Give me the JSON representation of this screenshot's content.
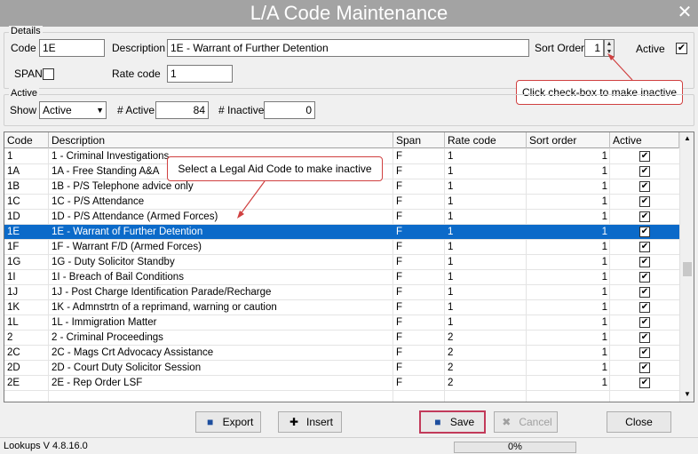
{
  "window": {
    "title": "L/A Code Maintenance",
    "close_glyph": "✕"
  },
  "details": {
    "legend": "Details",
    "code_label": "Code",
    "code_value": "1E",
    "description_label": "Description",
    "description_value": "1E - Warrant of Further Detention",
    "sort_order_label": "Sort Order",
    "sort_order_value": "1",
    "active_label": "Active",
    "active_checked": true,
    "span_label": "SPAN",
    "span_checked": false,
    "rate_code_label": "Rate code",
    "rate_code_value": "1"
  },
  "callouts": {
    "checkbox": "Click check-box to make inactive",
    "select": "Select a Legal Aid Code to make inactive"
  },
  "active_filter": {
    "legend": "Active",
    "show_label": "Show",
    "show_value": "Active",
    "active_count_label": "# Active",
    "active_count": "84",
    "inactive_count_label": "# Inactive",
    "inactive_count": "0"
  },
  "grid": {
    "columns": [
      "Code",
      "Description",
      "Span",
      "Rate code",
      "Sort order",
      "Active"
    ],
    "rows": [
      {
        "code": "1",
        "description": "1 - Criminal Investigations",
        "span": "F",
        "rate": "1",
        "sort": "1",
        "active": "✔"
      },
      {
        "code": "1A",
        "description": "1A - Free Standing A&A",
        "span": "F",
        "rate": "1",
        "sort": "1",
        "active": "✔"
      },
      {
        "code": "1B",
        "description": "1B - P/S Telephone advice only",
        "span": "F",
        "rate": "1",
        "sort": "1",
        "active": "✔"
      },
      {
        "code": "1C",
        "description": "1C - P/S Attendance",
        "span": "F",
        "rate": "1",
        "sort": "1",
        "active": "✔"
      },
      {
        "code": "1D",
        "description": "1D - P/S Attendance (Armed Forces)",
        "span": "F",
        "rate": "1",
        "sort": "1",
        "active": "✔"
      },
      {
        "code": "1E",
        "description": "1E - Warrant of Further Detention",
        "span": "F",
        "rate": "1",
        "sort": "1",
        "active": "✔"
      },
      {
        "code": "1F",
        "description": "1F - Warrant F/D (Armed Forces)",
        "span": "F",
        "rate": "1",
        "sort": "1",
        "active": "✔"
      },
      {
        "code": "1G",
        "description": "1G - Duty Solicitor Standby",
        "span": "F",
        "rate": "1",
        "sort": "1",
        "active": "✔"
      },
      {
        "code": "1I",
        "description": "1I - Breach of Bail Conditions",
        "span": "F",
        "rate": "1",
        "sort": "1",
        "active": "✔"
      },
      {
        "code": "1J",
        "description": "1J - Post Charge Identification Parade/Recharge",
        "span": "F",
        "rate": "1",
        "sort": "1",
        "active": "✔"
      },
      {
        "code": "1K",
        "description": "1K - Admnstrtn of a reprimand, warning or caution",
        "span": "F",
        "rate": "1",
        "sort": "1",
        "active": "✔"
      },
      {
        "code": "1L",
        "description": "1L - Immigration Matter",
        "span": "F",
        "rate": "1",
        "sort": "1",
        "active": "✔"
      },
      {
        "code": "2",
        "description": "2 - Criminal Proceedings",
        "span": "F",
        "rate": "2",
        "sort": "1",
        "active": "✔"
      },
      {
        "code": "2C",
        "description": "2C - Mags Crt Advocacy Assistance",
        "span": "F",
        "rate": "2",
        "sort": "1",
        "active": "✔"
      },
      {
        "code": "2D",
        "description": "2D - Court Duty Solicitor Session",
        "span": "F",
        "rate": "2",
        "sort": "1",
        "active": "✔"
      },
      {
        "code": "2E",
        "description": "2E - Rep Order LSF",
        "span": "F",
        "rate": "2",
        "sort": "1",
        "active": "✔"
      }
    ],
    "selected_index": 5
  },
  "buttons": {
    "export": "Export",
    "insert": "Insert",
    "save": "Save",
    "cancel": "Cancel",
    "close": "Close"
  },
  "status": {
    "version": "Lookups V 4.8.16.0",
    "progress": "0%"
  },
  "colors": {
    "selection": "#0b6ac9",
    "callout_border": "#d04040",
    "title_bg": "#a3a3a3"
  }
}
